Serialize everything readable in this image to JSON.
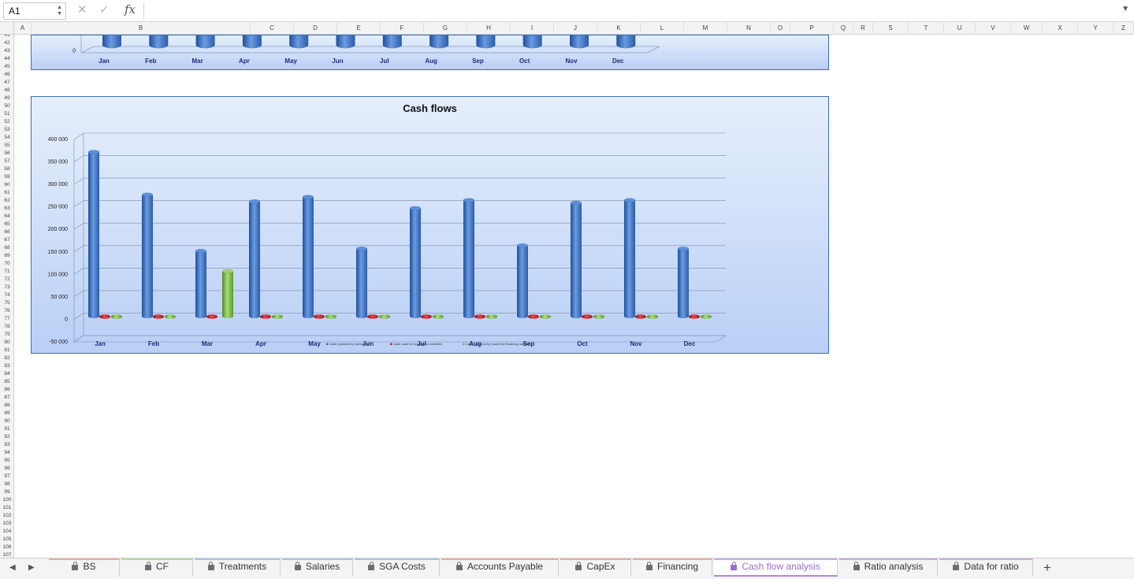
{
  "formula_bar": {
    "cell_reference": "A1",
    "cancel_icon": "✕",
    "enter_icon": "✓",
    "function_label": "fx",
    "formula_value": ""
  },
  "columns": [
    "A",
    "B",
    "C",
    "D",
    "E",
    "F",
    "G",
    "H",
    "I",
    "J",
    "K",
    "L",
    "M",
    "N",
    "O",
    "P",
    "Q",
    "R",
    "S",
    "T",
    "U",
    "V",
    "W",
    "X",
    "Y",
    "Z"
  ],
  "rows": [
    "41",
    "42",
    "43",
    "44",
    "45",
    "46",
    "47",
    "48",
    "49",
    "50",
    "51",
    "52",
    "53",
    "54",
    "55",
    "56",
    "57",
    "58",
    "59",
    "60",
    "61",
    "62",
    "63",
    "64",
    "65",
    "66",
    "67",
    "68",
    "69",
    "70",
    "71",
    "72",
    "73",
    "74",
    "75",
    "76",
    "77",
    "78",
    "79",
    "80",
    "81",
    "82",
    "83",
    "84",
    "85",
    "86",
    "87",
    "88",
    "89",
    "90",
    "91",
    "92",
    "93",
    "94",
    "95",
    "96",
    "97",
    "98",
    "99",
    "100",
    "101",
    "102",
    "103",
    "104",
    "105",
    "106",
    "107"
  ],
  "top_chart": {
    "y_tick": "0",
    "categories": [
      "Jan",
      "Feb",
      "Mar",
      "Apr",
      "May",
      "Jun",
      "Jul",
      "Aug",
      "Sep",
      "Oct",
      "Nov",
      "Dec"
    ]
  },
  "chart_data": {
    "type": "bar",
    "title": "Cash flows",
    "categories": [
      "Jan",
      "Feb",
      "Mar",
      "Apr",
      "May",
      "Jun",
      "Jul",
      "Aug",
      "Sep",
      "Oct",
      "Nov",
      "Dec"
    ],
    "y_ticks": [
      "400 000",
      "350 000",
      "300 000",
      "250 000",
      "200 000",
      "150 000",
      "100 000",
      "50 000",
      "0",
      "-50 000"
    ],
    "ylim": [
      -50000,
      400000
    ],
    "grid": true,
    "legend_position": "bottom",
    "series": [
      {
        "name": "Cash provided by operations",
        "color": "#3a6fc0",
        "values": [
          365000,
          270000,
          145000,
          255000,
          265000,
          150000,
          240000,
          258000,
          157000,
          252000,
          258000,
          150000
        ]
      },
      {
        "name": "Cash used for investment activities",
        "color": "#c0242a",
        "values": [
          0,
          0,
          0,
          0,
          0,
          0,
          0,
          0,
          0,
          0,
          0,
          0
        ]
      },
      {
        "name": "Cash provided by (used for) financing activities",
        "color": "#7ab648",
        "values": [
          0,
          0,
          100000,
          0,
          0,
          0,
          0,
          0,
          0,
          0,
          0,
          0
        ]
      }
    ]
  },
  "tabs": [
    {
      "label": "BS",
      "color": "#f2a7a7",
      "locked": true,
      "active": false
    },
    {
      "label": "CF",
      "color": "#b7de94",
      "locked": true,
      "active": false
    },
    {
      "label": "Treatments",
      "color": "#a9c3ea",
      "locked": true,
      "active": false
    },
    {
      "label": "Salaries",
      "color": "#a9c3ea",
      "locked": true,
      "active": false
    },
    {
      "label": "SGA Costs",
      "color": "#a9c3ea",
      "locked": true,
      "active": false
    },
    {
      "label": "Accounts Payable",
      "color": "#f2a7a7",
      "locked": true,
      "active": false
    },
    {
      "label": "CapEx",
      "color": "#f2a7a7",
      "locked": true,
      "active": false
    },
    {
      "label": "Financing",
      "color": "#f2a7a7",
      "locked": true,
      "active": false
    },
    {
      "label": "Cash flow analysis",
      "color": "#c9aee6",
      "locked": true,
      "active": true
    },
    {
      "label": "Ratio analysis",
      "color": "#c9aee6",
      "locked": true,
      "active": false
    },
    {
      "label": "Data for ratio",
      "color": "#c9aee6",
      "locked": true,
      "active": false
    }
  ],
  "add_sheet_label": "+"
}
